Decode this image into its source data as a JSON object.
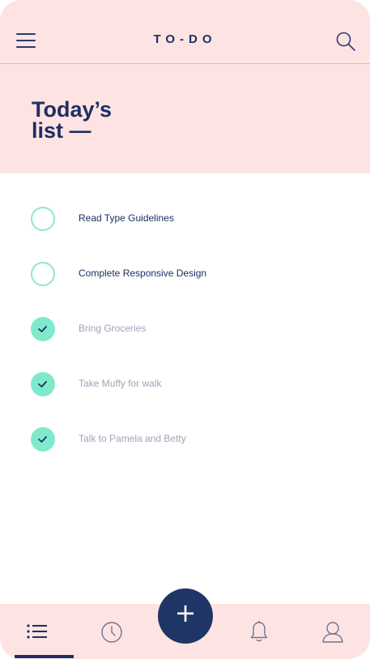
{
  "header": {
    "app_title": "TO-DO",
    "page_title_line1": "Today’s",
    "page_title_line2": "list —"
  },
  "tasks": [
    {
      "label": "Read Type Guidelines",
      "done": false
    },
    {
      "label": "Complete Responsive Design",
      "done": false
    },
    {
      "label": "Bring Groceries",
      "done": true
    },
    {
      "label": "Take Muffy for walk",
      "done": true
    },
    {
      "label": "Talk to Pamela and Betty",
      "done": true
    }
  ],
  "fab": {
    "symbol": "+"
  },
  "nav": {
    "items": [
      "list-icon",
      "clock-icon",
      "bell-icon",
      "user-icon"
    ],
    "active": "list-icon"
  },
  "colors": {
    "header_bg": "#fde4e2",
    "navy": "#1f2f63",
    "mint": "#7eeacb",
    "done_text": "#9ea4b8"
  }
}
